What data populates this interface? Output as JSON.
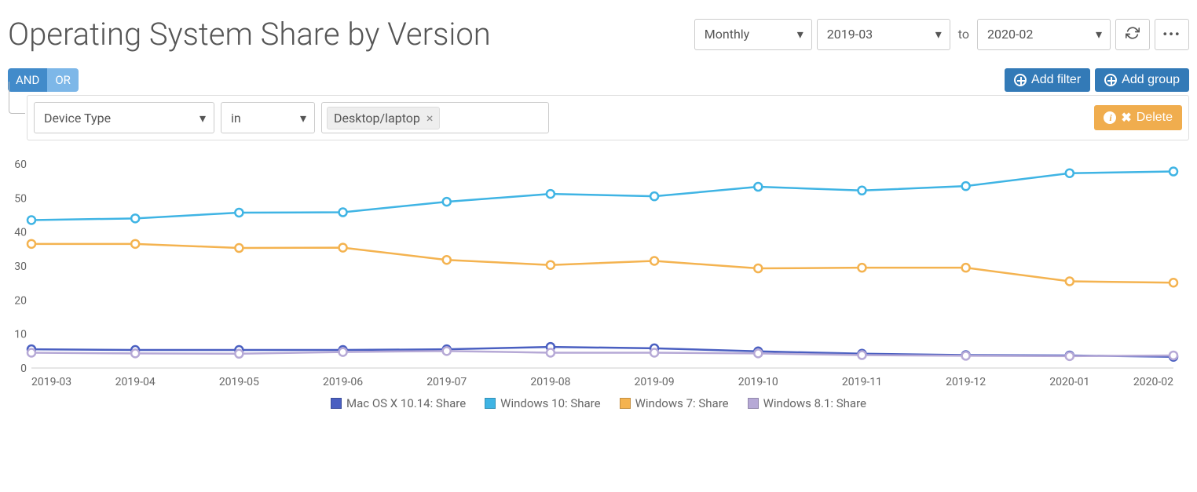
{
  "header": {
    "title": "Operating System Share by Version",
    "period_select": "Monthly",
    "from_date": "2019-03",
    "to_label": "to",
    "to_date": "2020-02"
  },
  "filter_bar": {
    "logic_and": "AND",
    "logic_or": "OR",
    "add_filter": "Add filter",
    "add_group": "Add group"
  },
  "filter_row": {
    "field": "Device Type",
    "operator": "in",
    "tag_label": "Desktop/laptop",
    "delete": "Delete"
  },
  "legend": {
    "s0": "Mac OS X 10.14: Share",
    "s1": "Windows 10: Share",
    "s2": "Windows 7: Share",
    "s3": "Windows 8.1: Share"
  },
  "colors": {
    "mac": "#4a5fc1",
    "win10": "#3fb4e4",
    "win7": "#f4b350",
    "win81": "#b6a9d6",
    "axis": "#888",
    "tick": "#666"
  },
  "chart_data": {
    "type": "line",
    "title": "Operating System Share by Version",
    "xlabel": "",
    "ylabel": "",
    "ylim": [
      0,
      60
    ],
    "yticks": [
      0,
      10,
      20,
      30,
      40,
      50,
      60
    ],
    "categories": [
      "2019-03",
      "2019-04",
      "2019-05",
      "2019-06",
      "2019-07",
      "2019-08",
      "2019-09",
      "2019-10",
      "2019-11",
      "2019-12",
      "2020-01",
      "2020-02"
    ],
    "series": [
      {
        "name": "Mac OS X 10.14: Share",
        "color": "#4a5fc1",
        "values": [
          5.5,
          5.3,
          5.3,
          5.3,
          5.5,
          6.2,
          5.8,
          4.9,
          4.2,
          3.8,
          3.7,
          3.3
        ]
      },
      {
        "name": "Windows 10: Share",
        "color": "#3fb4e4",
        "values": [
          43.5,
          44.0,
          45.7,
          45.8,
          48.9,
          51.2,
          50.5,
          53.3,
          52.2,
          53.5,
          57.3,
          57.8
        ]
      },
      {
        "name": "Windows 7: Share",
        "color": "#f4b350",
        "values": [
          36.5,
          36.5,
          35.3,
          35.4,
          31.8,
          30.3,
          31.5,
          29.3,
          29.5,
          29.5,
          25.5,
          25.1
        ]
      },
      {
        "name": "Windows 8.1: Share",
        "color": "#b6a9d6",
        "values": [
          4.5,
          4.3,
          4.2,
          4.7,
          5.0,
          4.5,
          4.5,
          4.3,
          3.8,
          3.6,
          3.5,
          3.7
        ]
      }
    ]
  }
}
